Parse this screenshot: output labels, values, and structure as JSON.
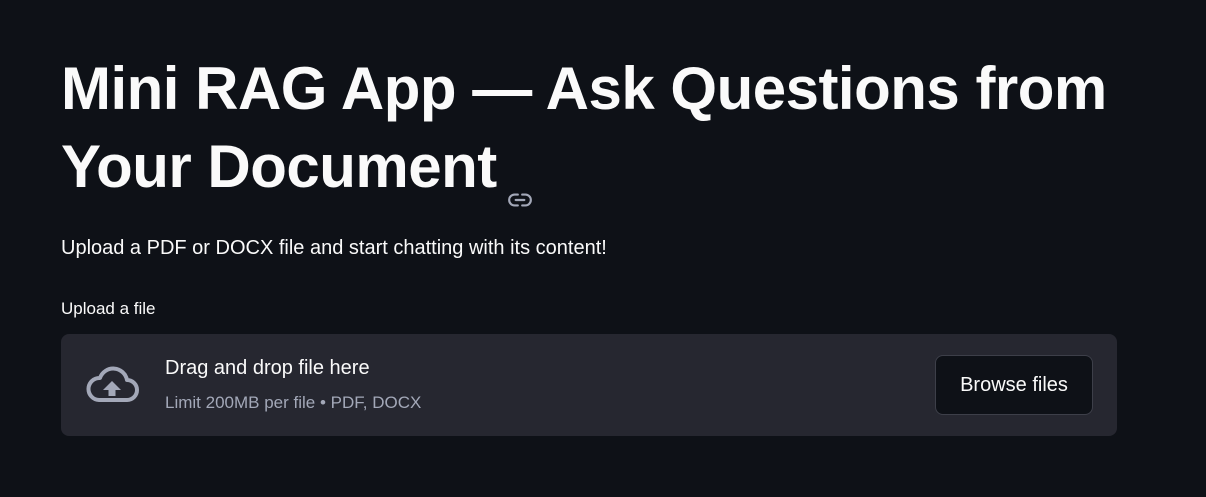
{
  "page": {
    "title": "Mini RAG App — Ask Questions from Your Document",
    "subtitle": "Upload a PDF or DOCX file and start chatting with its content!"
  },
  "uploader": {
    "label": "Upload a file",
    "drop_text": "Drag and drop file here",
    "limit_text": "Limit 200MB per file • PDF, DOCX",
    "browse_label": "Browse files"
  },
  "icons": {
    "title_anchor": "link-icon",
    "dropzone": "cloud-upload-icon"
  },
  "colors": {
    "background": "#0e1117",
    "dropzone": "#262730",
    "text": "#fafafa",
    "muted_text": "#a3a8b8"
  }
}
